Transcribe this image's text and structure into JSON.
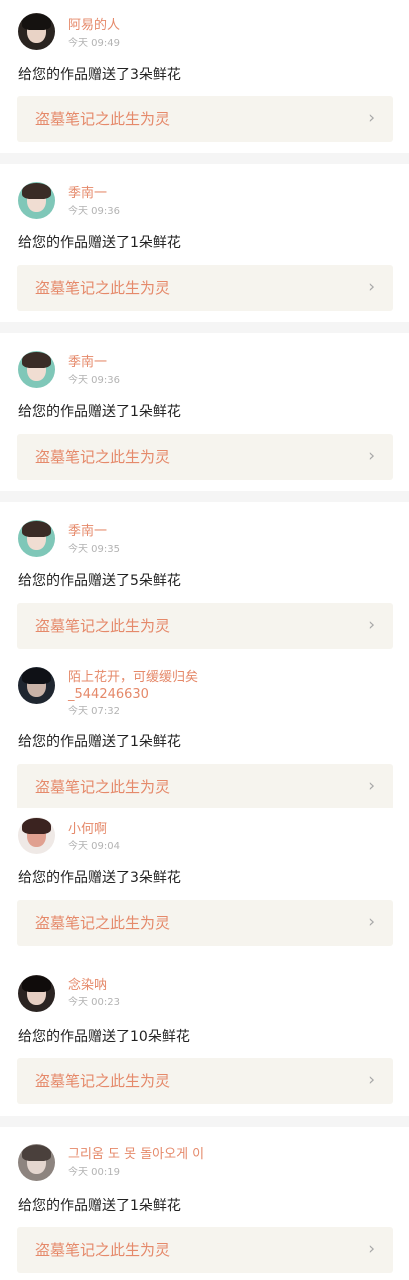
{
  "entries": [
    {
      "name": "阿易的人",
      "time": "今天 09:49",
      "message": "给您的作品赠送了3朵鲜花",
      "work_title": "盗墓笔记之此生为灵",
      "avatar": "avatar-dark-hair"
    },
    {
      "name": "季南一",
      "time": "今天 09:36",
      "message": "给您的作品赠送了1朵鲜花",
      "work_title": "盗墓笔记之此生为灵",
      "avatar": "avatar-boy-teal"
    },
    {
      "name": "季南一",
      "time": "今天 09:36",
      "message": "给您的作品赠送了1朵鲜花",
      "work_title": "盗墓笔记之此生为灵",
      "avatar": "avatar-boy-teal"
    },
    {
      "name": "季南一",
      "time": "今天 09:35",
      "message": "给您的作品赠送了5朵鲜花",
      "work_title": "盗墓笔记之此生为灵",
      "avatar": "avatar-boy-teal"
    },
    {
      "name": "陌上花开，可缓缓归矣_544246630",
      "time": "今天 07:32",
      "message": "给您的作品赠送了1朵鲜花",
      "work_title": "盗墓笔记之此生为灵",
      "avatar": "avatar-dark-red"
    },
    {
      "name": "小何啊",
      "time": "今天 09:04",
      "message": "给您的作品赠送了3朵鲜花",
      "work_title": "盗墓笔记之此生为灵",
      "avatar": "avatar-red-face"
    },
    {
      "name": "念染呐",
      "time": "今天 00:23",
      "message": "给您的作品赠送了10朵鲜花",
      "work_title": "盗墓笔记之此生为灵",
      "avatar": "avatar-dark-hair"
    },
    {
      "name": "그리움 도 못 돌아오게 이",
      "time": "今天 00:19",
      "message": "给您的作品赠送了1朵鲜花",
      "work_title": "盗墓笔记之此生为灵",
      "avatar": "avatar-grey-hair"
    }
  ],
  "chevron_icon": "›",
  "colors": {
    "accent": "#e5896a",
    "link_bg": "#f6f4ee",
    "separator": "#f5f5f5"
  }
}
